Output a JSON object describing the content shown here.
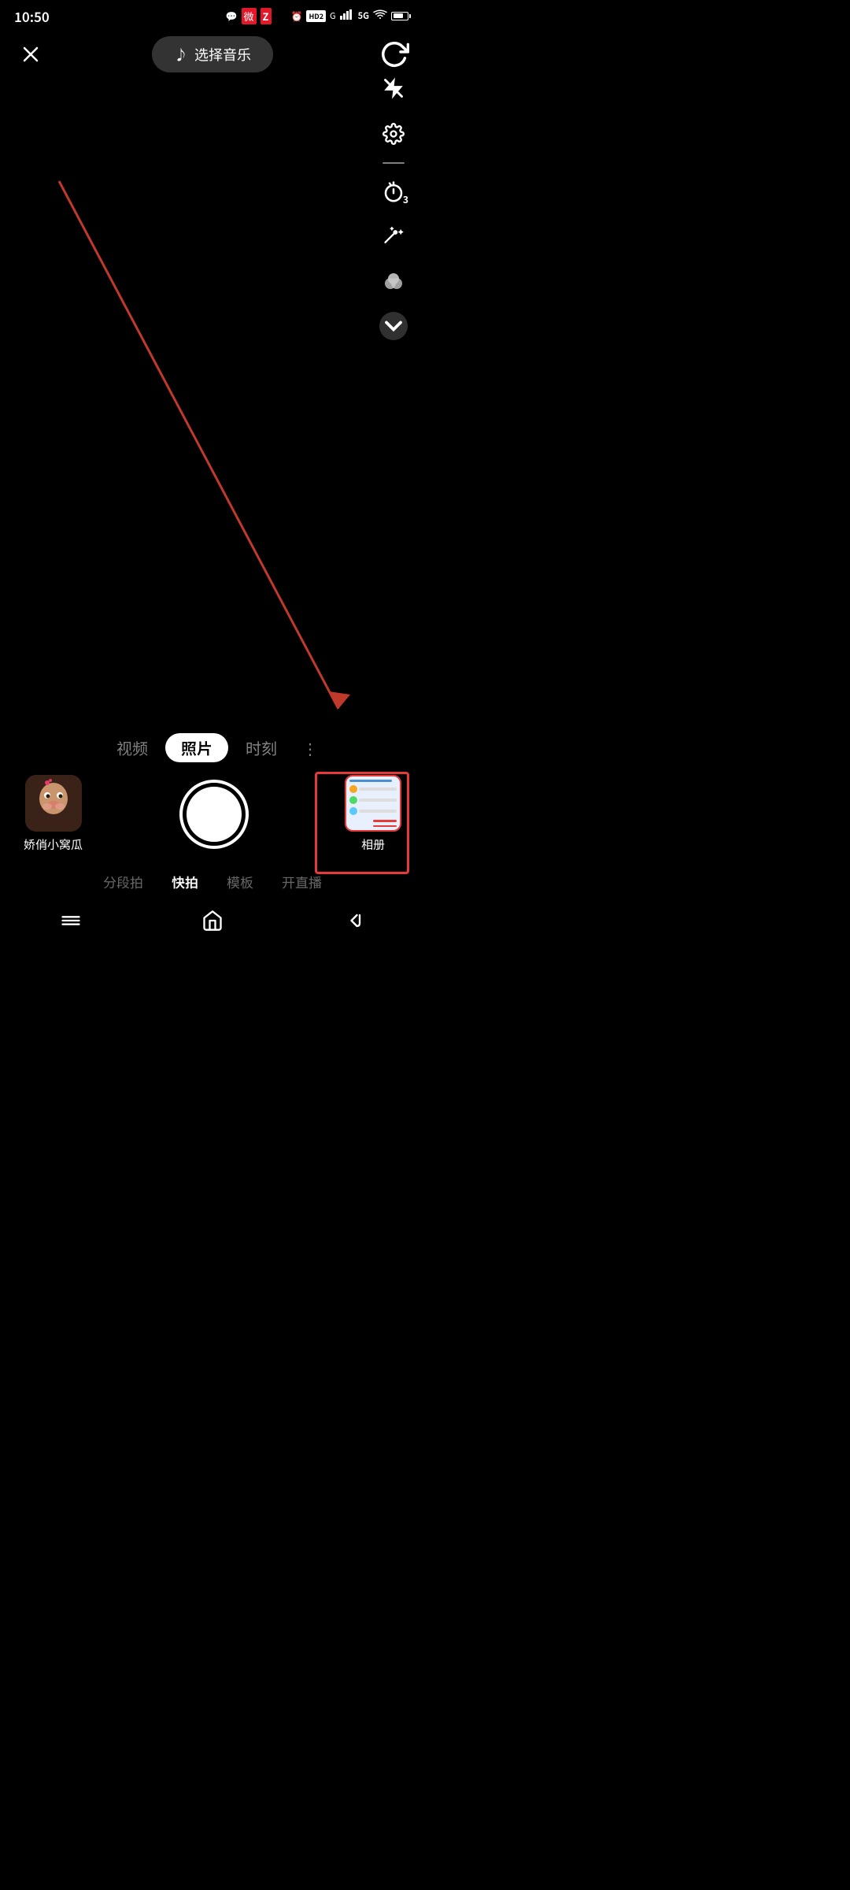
{
  "statusBar": {
    "time": "10:50",
    "batteryLevel": 69,
    "signals": [
      "HD2",
      "G",
      "5G"
    ]
  },
  "topBar": {
    "closeLabel": "×",
    "musicLabel": "选择音乐",
    "musicNote": "♪"
  },
  "rightIcons": [
    {
      "name": "refresh-icon",
      "label": "refresh"
    },
    {
      "name": "flash-off-icon",
      "label": "flash-off"
    },
    {
      "name": "settings-icon",
      "label": "settings"
    },
    {
      "name": "timer-icon",
      "label": "timer",
      "timerNum": "3"
    },
    {
      "name": "beauty-icon",
      "label": "beauty"
    },
    {
      "name": "color-icon",
      "label": "color"
    },
    {
      "name": "more-icon",
      "label": "more"
    }
  ],
  "modeTabs": [
    {
      "id": "video",
      "label": "视频",
      "active": false
    },
    {
      "id": "photo",
      "label": "照片",
      "active": true
    },
    {
      "id": "moment",
      "label": "时刻",
      "active": false
    }
  ],
  "subTabs": [
    {
      "id": "segment",
      "label": "分段拍",
      "active": false
    },
    {
      "id": "quick",
      "label": "快拍",
      "active": true
    },
    {
      "id": "template",
      "label": "模板",
      "active": false
    },
    {
      "id": "live",
      "label": "开直播",
      "active": false
    }
  ],
  "avatar": {
    "label": "娇俏小窝瓜",
    "emoji": "🐱"
  },
  "album": {
    "label": "相册"
  },
  "redBox": {
    "arrowText": "→"
  }
}
